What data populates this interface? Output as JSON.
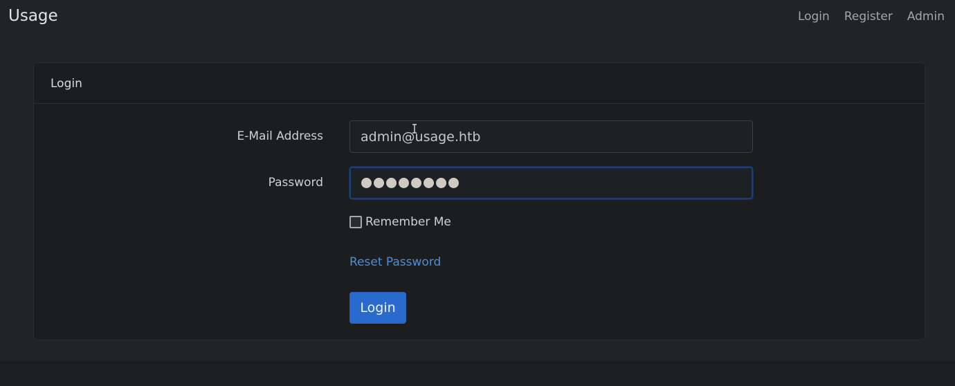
{
  "navbar": {
    "brand": "Usage",
    "links": [
      "Login",
      "Register",
      "Admin"
    ]
  },
  "card": {
    "title": "Login"
  },
  "form": {
    "email_label": "E-Mail Address",
    "email_value": "admin@usage.htb",
    "password_label": "Password",
    "password_masked_count": 8,
    "remember_label": "Remember Me",
    "remember_checked": false,
    "reset_link": "Reset Password",
    "submit_label": "Login"
  },
  "colors": {
    "accent": "#2a6acf",
    "link": "#4c8fd8",
    "background": "#222326",
    "card": "#1b1d1f"
  },
  "icons": {
    "mouse_cursor": "text-cursor-icon"
  }
}
